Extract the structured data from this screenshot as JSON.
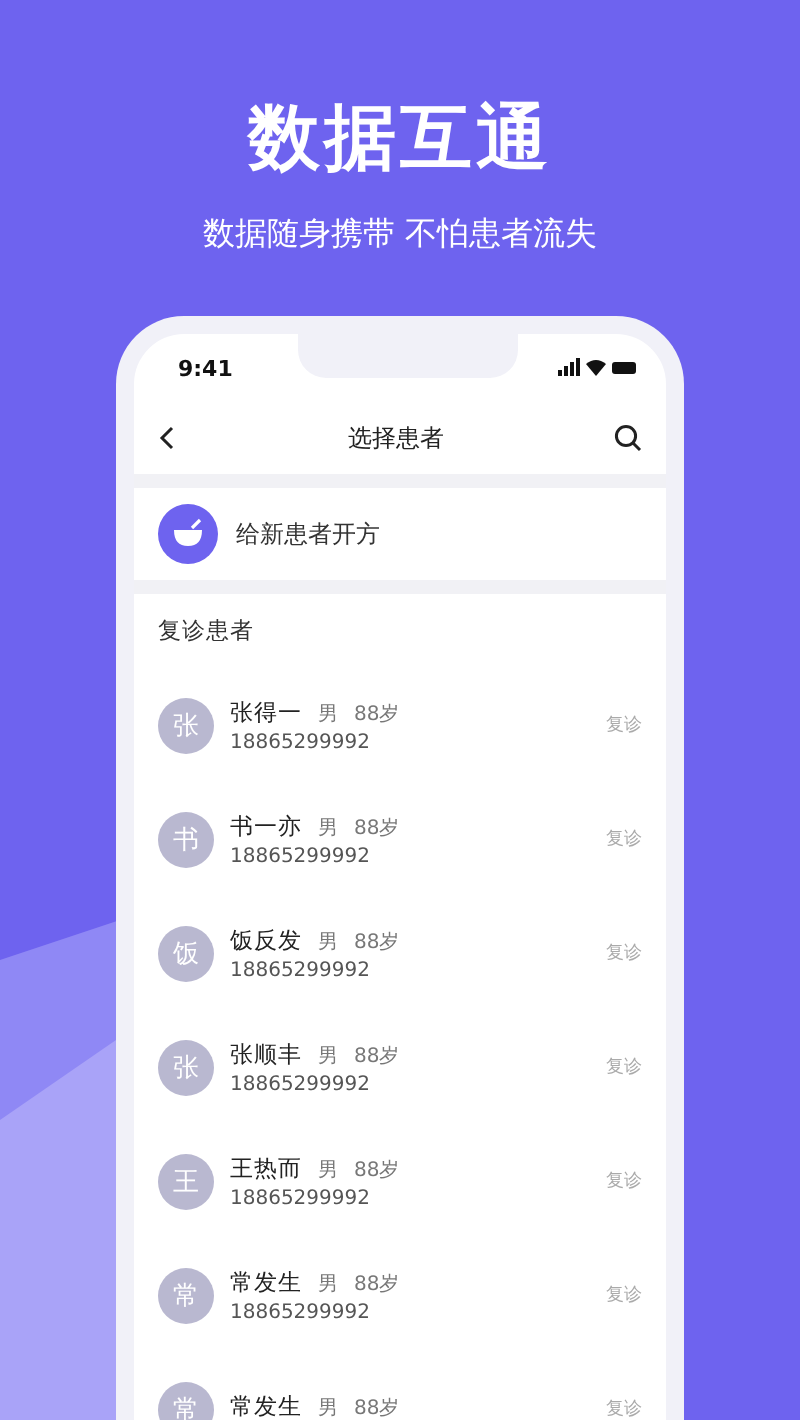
{
  "hero": {
    "title": "数据互通",
    "subtitle": "数据随身携带 不怕患者流失"
  },
  "status_bar": {
    "time": "9:41"
  },
  "nav": {
    "title": "选择患者"
  },
  "new_patient": {
    "label": "给新患者开方"
  },
  "section": {
    "title": "复诊患者"
  },
  "patients": [
    {
      "avatar": "张",
      "name": "张得一",
      "gender": "男",
      "age": "88岁",
      "phone": "18865299992",
      "tag": "复诊"
    },
    {
      "avatar": "书",
      "name": "书一亦",
      "gender": "男",
      "age": "88岁",
      "phone": "18865299992",
      "tag": "复诊"
    },
    {
      "avatar": "饭",
      "name": "饭反发",
      "gender": "男",
      "age": "88岁",
      "phone": "18865299992",
      "tag": "复诊"
    },
    {
      "avatar": "张",
      "name": "张顺丰",
      "gender": "男",
      "age": "88岁",
      "phone": "18865299992",
      "tag": "复诊"
    },
    {
      "avatar": "王",
      "name": "王热而",
      "gender": "男",
      "age": "88岁",
      "phone": "18865299992",
      "tag": "复诊"
    },
    {
      "avatar": "常",
      "name": "常发生",
      "gender": "男",
      "age": "88岁",
      "phone": "18865299992",
      "tag": "复诊"
    },
    {
      "avatar": "常",
      "name": "常发生",
      "gender": "男",
      "age": "88岁",
      "tag": "复诊"
    }
  ]
}
